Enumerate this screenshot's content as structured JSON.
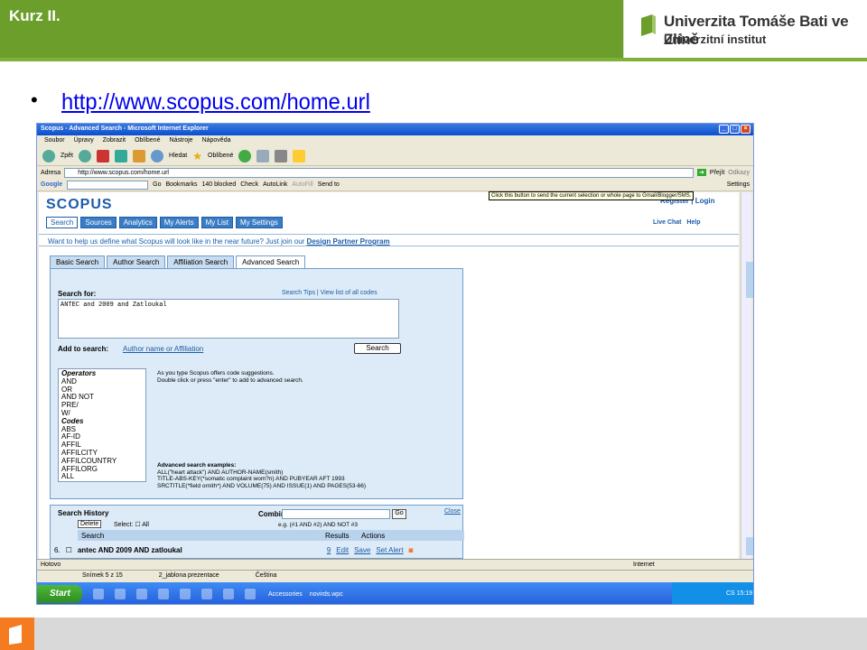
{
  "slide": {
    "title": "Kurz II.",
    "uni_line1": "Univerzita Tomáše Bati ve Zlíně",
    "uni_line2": "Univerzitní institut",
    "bullet": "•",
    "url": "http://www.scopus.com/home.url"
  },
  "browser": {
    "window_title": "Scopus - Advanced Search - Microsoft Internet Explorer",
    "menu": [
      "Soubor",
      "Úpravy",
      "Zobrazit",
      "Oblíbené",
      "Nástroje",
      "Nápověda"
    ],
    "toolbar": {
      "back": "Zpět",
      "search": "Hledat",
      "favorites": "Oblíbené"
    },
    "address_label": "Adresa",
    "address_value": "http://www.scopus.com/home.url",
    "go_label": "Přejít",
    "links_label": "Odkazy",
    "google_label": "Google",
    "google_go": "Go",
    "bookmarks": "Bookmarks",
    "blocked": "140 blocked",
    "check": "Check",
    "autolink": "AutoLink",
    "autofill": "AutoFill",
    "sendto": "Send to",
    "settings": "Settings",
    "tooltip": "Click this button to send the current selection or whole page to Gmail/Blogger/SMS.",
    "status": "Hotovo",
    "zone": "Internet"
  },
  "scopus": {
    "logo": "SCOPUS",
    "nav": [
      "Search",
      "Sources",
      "Analytics",
      "My Alerts",
      "My List",
      "My Settings"
    ],
    "register": "Register",
    "login": "Login",
    "live_chat": "Live Chat",
    "help": "Help",
    "promo_text": "Want to help us define what Scopus will look like in the near future? Just join our",
    "promo_link": "Design Partner Program",
    "search_tabs": [
      "Basic Search",
      "Author Search",
      "Affiliation Search",
      "Advanced Search"
    ],
    "search_for": "Search for:",
    "search_tips": "Search Tips",
    "view_codes": "View list of all codes",
    "query": "ANTEC and 2009 and Zatloukal",
    "add_to_search": "Add to search:",
    "author_link": "Author name or Affiliation",
    "search_button": "Search",
    "operators": [
      {
        "t": "Operators",
        "h": true
      },
      {
        "t": "AND"
      },
      {
        "t": "OR"
      },
      {
        "t": "AND NOT"
      },
      {
        "t": "PRE/"
      },
      {
        "t": "W/"
      },
      {
        "t": "Codes",
        "h": true
      },
      {
        "t": "ABS"
      },
      {
        "t": "AF-ID"
      },
      {
        "t": "AFFIL"
      },
      {
        "t": "AFFILCITY"
      },
      {
        "t": "AFFILCOUNTRY"
      },
      {
        "t": "AFFILORG"
      },
      {
        "t": "ALL"
      }
    ],
    "suggest1": "As you type Scopus offers code suggestions.",
    "suggest2": "Double click or press \"enter\" to add to advanced search.",
    "ex_title": "Advanced search examples:",
    "ex1": "ALL(\"heart attack\") AND AUTHOR-NAME(smith)",
    "ex2": "TITLE-ABS-KEY(*somatic complaint wom?n) AND PUBYEAR AFT 1993",
    "ex3": "SRCTITLE(*field ornith*) AND VOLUME(75) AND ISSUE(1) AND PAGES(53-66)",
    "history_title": "Search History",
    "combine": "Combine",
    "go": "Go",
    "close": "Close",
    "eg": "e.g. (#1 AND #2) AND NOT #3",
    "delete": "Delete",
    "select": "Select:",
    "all": "All",
    "col_search": "Search",
    "col_results": "Results",
    "col_actions": "Actions",
    "row_num": "6.",
    "row_query": "antec AND 2009 AND zatloukal",
    "row_results": "9",
    "row_edit": "Edit",
    "row_save": "Save",
    "row_alert": "Set Alert"
  },
  "taskbar": {
    "start": "Start",
    "slide_no": "Snímek 5 z 15",
    "template": "2_jablona prezentace",
    "lang": "Čeština",
    "tray1": "Accessories",
    "tray2": "novirds.wpc",
    "cs": "CS",
    "time": "15:19"
  }
}
